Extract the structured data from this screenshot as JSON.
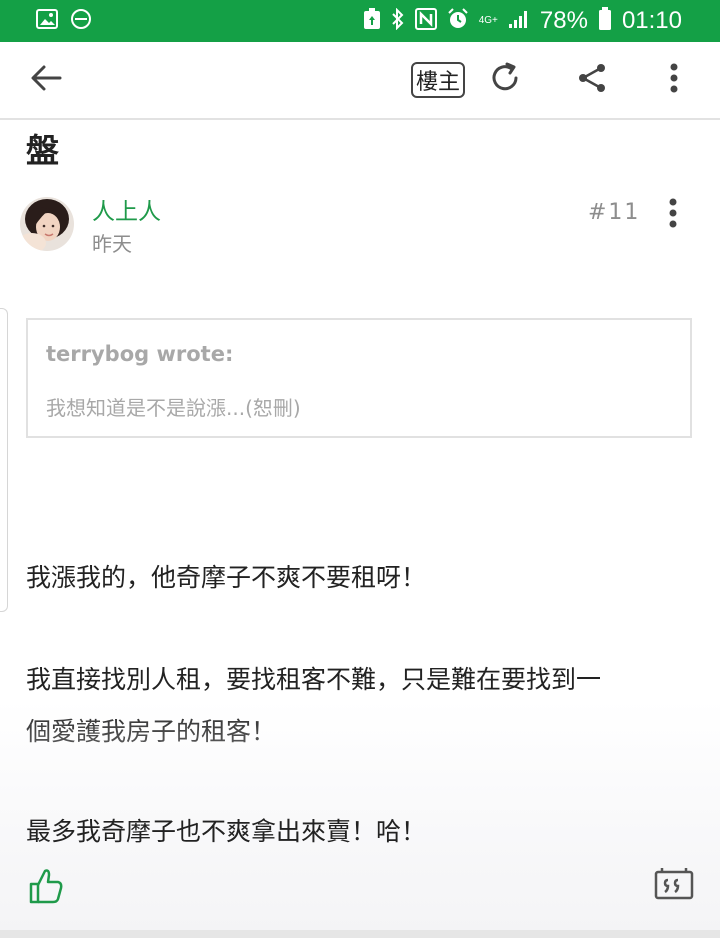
{
  "status_bar": {
    "battery_percent": "78%",
    "time": "01:10",
    "network_label": "4G+"
  },
  "toolbar": {
    "louzhu_label": "樓主"
  },
  "post": {
    "title_fragment": "盤",
    "author": "人上人",
    "timestamp": "昨天",
    "floor": "#11",
    "quote": {
      "author_line": "terrybog wrote:",
      "text": "我想知道是不是說漲...(恕刪)"
    },
    "paragraphs": [
      "我漲我的，他奇摩子不爽不要租呀！",
      "我直接找別人租，要找租客不難，只是難在要找到一",
      "個愛護我房子的租客！",
      "最多我奇摩子也不爽拿出來賣！哈！"
    ]
  },
  "colors": {
    "status_green": "#14a046",
    "author_green": "#1f9a4a",
    "muted_gray": "#8d8d8d"
  },
  "icons": [
    "image-icon",
    "do-not-disturb-icon",
    "recycle-icon",
    "bluetooth-icon",
    "nfc-icon",
    "alarm-icon",
    "signal-icon",
    "battery-icon",
    "back-arrow-icon",
    "refresh-icon",
    "share-icon",
    "more-vert-icon",
    "thumbs-up-icon",
    "quote-icon"
  ]
}
